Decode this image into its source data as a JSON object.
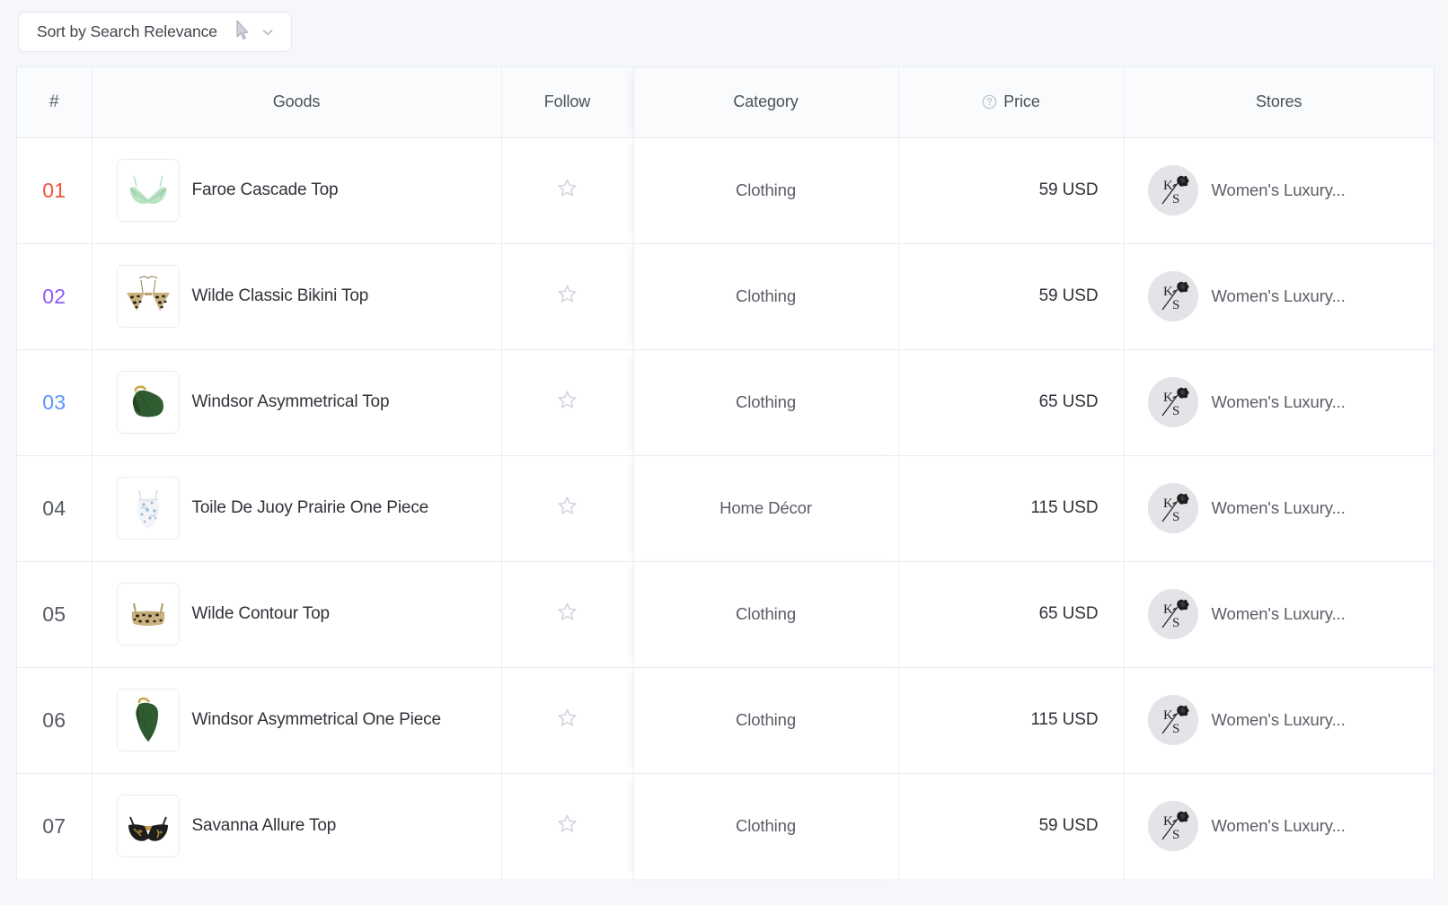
{
  "toolbar": {
    "sort_label": "Sort by Search Relevance",
    "chevron_icon": "chevron-down-icon"
  },
  "table": {
    "columns": [
      {
        "key": "rank",
        "label": "#"
      },
      {
        "key": "goods",
        "label": "Goods"
      },
      {
        "key": "follow",
        "label": "Follow"
      },
      {
        "key": "category",
        "label": "Category"
      },
      {
        "key": "price",
        "label": "Price",
        "icon": "help-circle-icon"
      },
      {
        "key": "stores",
        "label": "Stores"
      }
    ],
    "rows": [
      {
        "rank": "01",
        "rank_color": "#f0543c",
        "rank_style": "rank-1",
        "name": "Faroe Cascade Top",
        "thumb": "mint-green-bikini-top",
        "follow_icon": "star-outline-icon",
        "category": "Clothing",
        "price": "59 USD",
        "store": "Women's Luxury...",
        "store_avatar": "ks-rose-logo"
      },
      {
        "rank": "02",
        "rank_color": "#8b5cf6",
        "rank_style": "rank-2",
        "name": "Wilde Classic Bikini Top",
        "thumb": "leopard-triangle-bikini-top",
        "follow_icon": "star-outline-icon",
        "category": "Clothing",
        "price": "59 USD",
        "store": "Women's Luxury...",
        "store_avatar": "ks-rose-logo"
      },
      {
        "rank": "03",
        "rank_color": "#5a95f5",
        "rank_style": "rank-3",
        "name": "Windsor Asymmetrical Top",
        "thumb": "green-asymmetrical-top",
        "follow_icon": "star-outline-icon",
        "category": "Clothing",
        "price": "65 USD",
        "store": "Women's Luxury...",
        "store_avatar": "ks-rose-logo"
      },
      {
        "rank": "04",
        "rank_color": "#565a62",
        "rank_style": "rank-n",
        "name": "Toile De Juoy Prairie One Piece",
        "thumb": "toile-print-one-piece",
        "follow_icon": "star-outline-icon",
        "category": "Home Décor",
        "price": "115 USD",
        "store": "Women's Luxury...",
        "store_avatar": "ks-rose-logo"
      },
      {
        "rank": "05",
        "rank_color": "#565a62",
        "rank_style": "rank-n",
        "name": "Wilde Contour Top",
        "thumb": "leopard-bralette-top",
        "follow_icon": "star-outline-icon",
        "category": "Clothing",
        "price": "65 USD",
        "store": "Women's Luxury...",
        "store_avatar": "ks-rose-logo"
      },
      {
        "rank": "06",
        "rank_color": "#565a62",
        "rank_style": "rank-n",
        "name": "Windsor Asymmetrical One Piece",
        "thumb": "green-asymmetrical-one-piece",
        "follow_icon": "star-outline-icon",
        "category": "Clothing",
        "price": "115 USD",
        "store": "Women's Luxury...",
        "store_avatar": "ks-rose-logo"
      },
      {
        "rank": "07",
        "rank_color": "#565a62",
        "rank_style": "rank-n",
        "name": "Savanna Allure Top",
        "thumb": "black-gold-bra-top",
        "follow_icon": "star-outline-icon",
        "category": "Clothing",
        "price": "59 USD",
        "store": "Women's Luxury...",
        "store_avatar": "ks-rose-logo"
      }
    ]
  },
  "colors": {
    "page_background": "#f6f7fa",
    "table_background": "#ffffff",
    "header_background": "#fafbfd",
    "border": "#e7eaf0",
    "rank_first": "#f0543c",
    "rank_second": "#8b5cf6",
    "rank_third": "#5a95f5",
    "text_primary": "#2f3238",
    "text_secondary": "#595d66"
  }
}
